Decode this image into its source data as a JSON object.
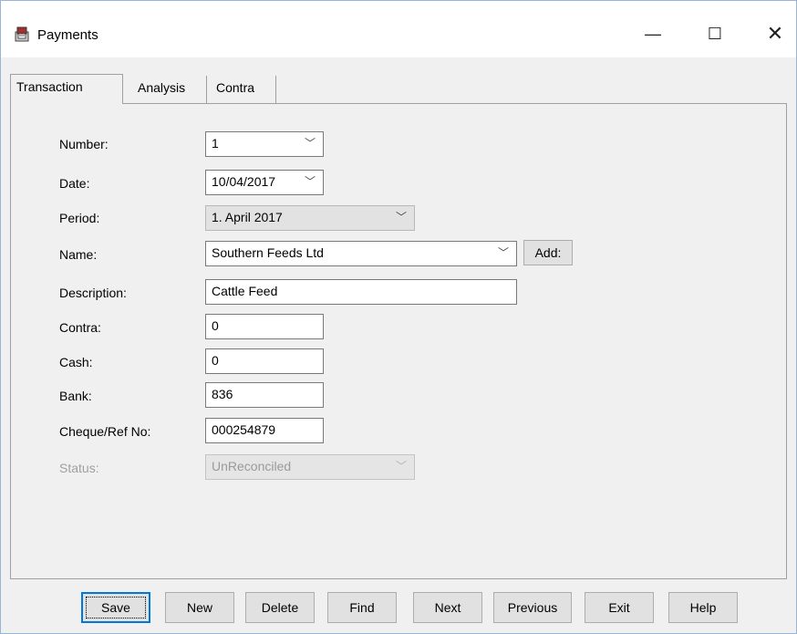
{
  "window": {
    "title": "Payments"
  },
  "titlebar": {
    "minimize": "—",
    "maximize": "☐",
    "close": "✕"
  },
  "tabs": [
    {
      "label": "Transaction",
      "active": true
    },
    {
      "label": "Analysis",
      "active": false
    },
    {
      "label": "Contra",
      "active": false
    }
  ],
  "form": {
    "number": {
      "label": "Number:",
      "value": "1"
    },
    "date": {
      "label": "Date:",
      "value": "10/04/2017"
    },
    "period": {
      "label": "Period:",
      "value": "1. April 2017"
    },
    "name": {
      "label": "Name:",
      "value": "Southern Feeds Ltd",
      "add_label": "Add:"
    },
    "description": {
      "label": "Description:",
      "value": "Cattle Feed"
    },
    "contra": {
      "label": "Contra:",
      "value": "0"
    },
    "cash": {
      "label": "Cash:",
      "value": "0"
    },
    "bank": {
      "label": "Bank:",
      "value": "836"
    },
    "cheque": {
      "label": "Cheque/Ref No:",
      "value": "000254879"
    },
    "status": {
      "label": "Status:",
      "value": "UnReconciled"
    }
  },
  "buttons": {
    "save": "Save",
    "new": "New",
    "delete": "Delete",
    "find": "Find",
    "next": "Next",
    "previous": "Previous",
    "exit": "Exit",
    "help": "Help"
  },
  "icons": {
    "app": "payments-app-icon",
    "chevron": "chevron-down-icon"
  }
}
